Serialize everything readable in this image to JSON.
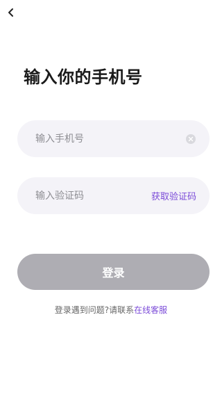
{
  "header": {
    "back_icon": "chevron-left-icon"
  },
  "page": {
    "title": "输入你的手机号"
  },
  "phone_field": {
    "placeholder": "输入手机号",
    "value": "",
    "clear_icon": "clear-circle-icon"
  },
  "code_field": {
    "placeholder": "输入验证码",
    "value": "",
    "get_code_label": "获取验证码"
  },
  "login_button": {
    "label": "登录",
    "state": "disabled"
  },
  "help": {
    "text": "登录遇到问题?请联系",
    "link": "在线客服"
  },
  "colors": {
    "accent": "#7b4bd8",
    "field_bg": "#f4f3f8",
    "button_disabled": "#aeadb3"
  }
}
